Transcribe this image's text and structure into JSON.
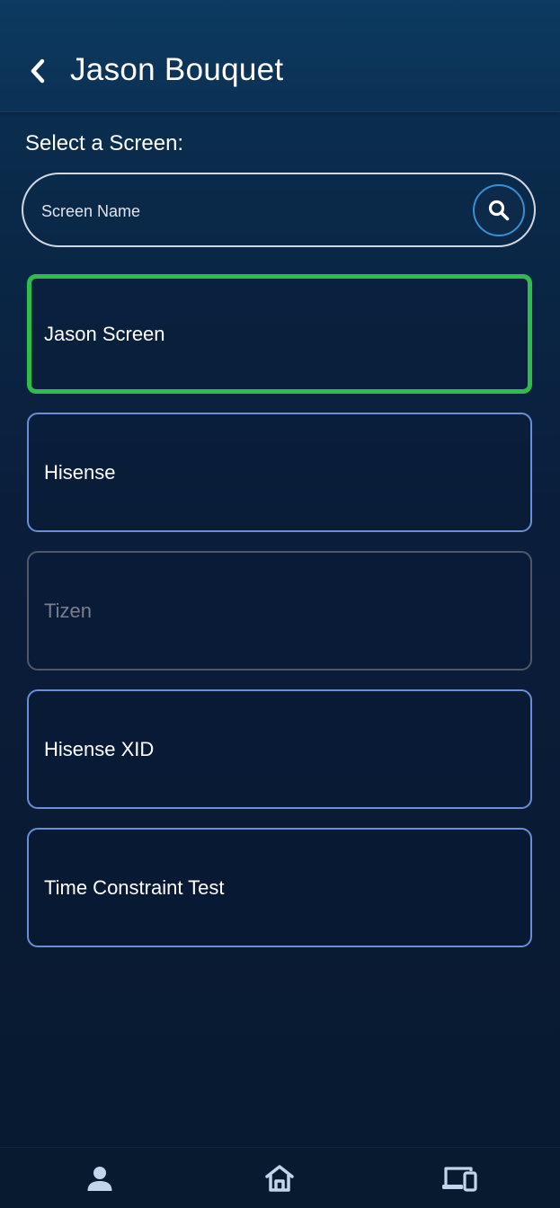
{
  "header": {
    "title": "Jason Bouquet",
    "back_icon": "chevron-left-icon"
  },
  "select_label": "Select a Screen:",
  "search": {
    "placeholder": "Screen Name",
    "value": "",
    "icon": "search-icon"
  },
  "screens": [
    {
      "label": "Jason Screen",
      "state": "selected"
    },
    {
      "label": "Hisense",
      "state": "available"
    },
    {
      "label": "Tizen",
      "state": "disabled"
    },
    {
      "label": "Hisense XID",
      "state": "available"
    },
    {
      "label": "Time Constraint Test",
      "state": "available"
    }
  ],
  "bottom_nav": [
    {
      "icon": "person-icon"
    },
    {
      "icon": "home-icon"
    },
    {
      "icon": "devices-icon"
    }
  ],
  "colors": {
    "selected_border": "#2ebd4a",
    "item_border": "#6b8fd6",
    "disabled_border": "#4e5968",
    "disabled_text": "#777f8b",
    "search_button_ring": "#3b8fd0"
  }
}
